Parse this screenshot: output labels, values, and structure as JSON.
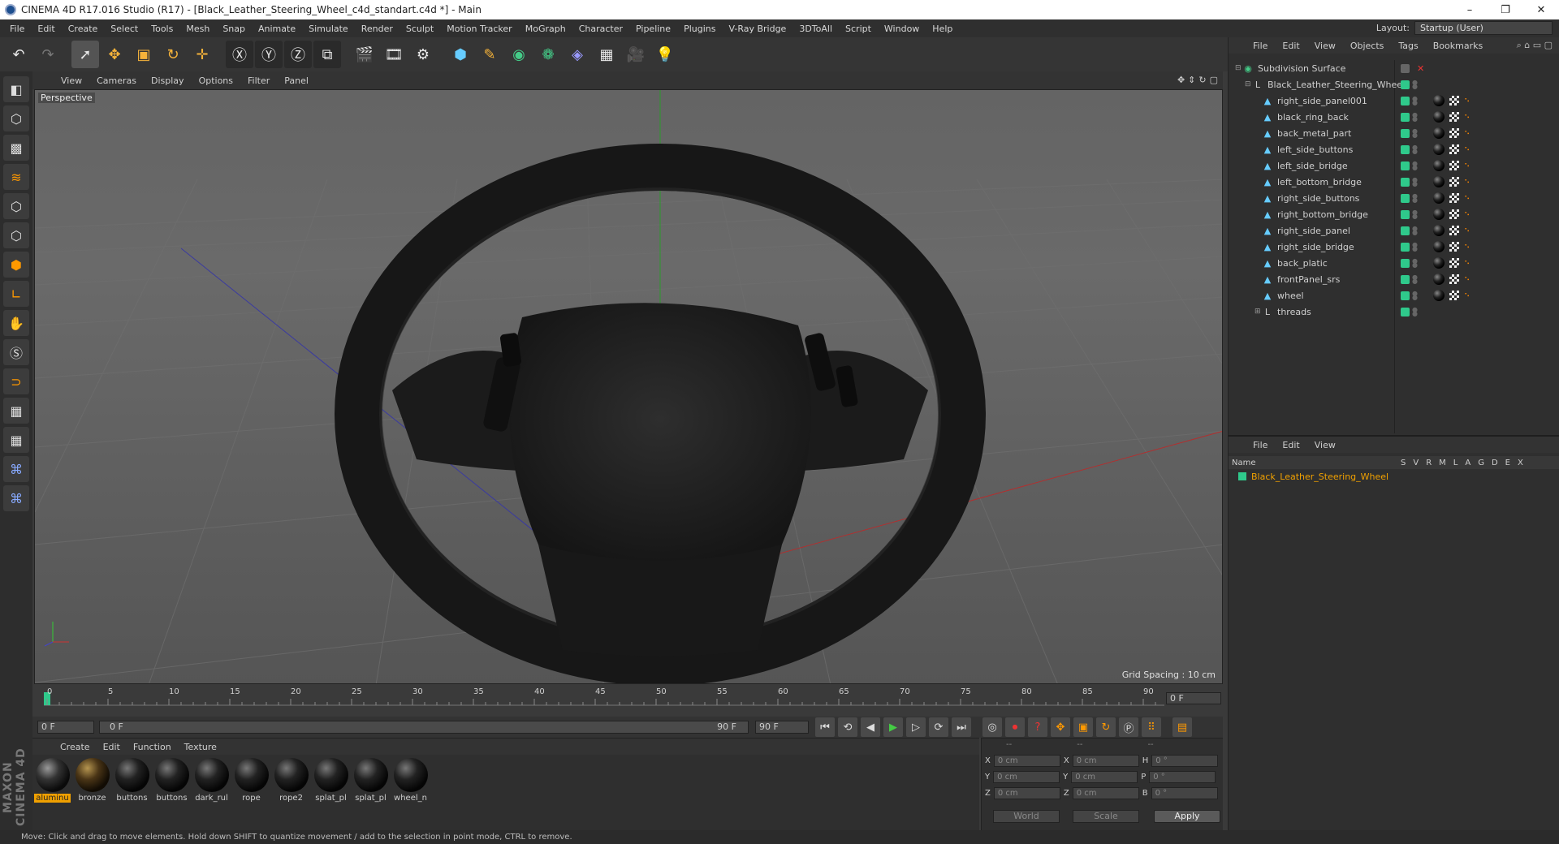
{
  "window": {
    "title": "CINEMA 4D R17.016 Studio (R17) - [Black_Leather_Steering_Wheel_c4d_standart.c4d *] - Main",
    "min": "–",
    "max": "❐",
    "close": "✕"
  },
  "menu": [
    "File",
    "Edit",
    "Create",
    "Select",
    "Tools",
    "Mesh",
    "Snap",
    "Animate",
    "Simulate",
    "Render",
    "Sculpt",
    "Motion Tracker",
    "MoGraph",
    "Character",
    "Pipeline",
    "Plugins",
    "V-Ray Bridge",
    "3DToAll",
    "Script",
    "Window",
    "Help"
  ],
  "layout": {
    "label": "Layout:",
    "value": "Startup (User)"
  },
  "viewport": {
    "menu": [
      "View",
      "Cameras",
      "Display",
      "Options",
      "Filter",
      "Panel"
    ],
    "label": "Perspective",
    "grid_spacing": "Grid Spacing : 10 cm"
  },
  "timeline": {
    "ticks": [
      "0",
      "5",
      "10",
      "15",
      "20",
      "25",
      "30",
      "35",
      "40",
      "45",
      "50",
      "55",
      "60",
      "65",
      "70",
      "75",
      "80",
      "85",
      "90"
    ],
    "current_frame": "0 F",
    "start": "0 F",
    "slider_start": "0 F",
    "slider_end": "90 F",
    "end": "90 F"
  },
  "materials": {
    "menu": [
      "Create",
      "Edit",
      "Function",
      "Texture"
    ],
    "items": [
      {
        "name": "aluminu",
        "kind": "alum",
        "selected": true
      },
      {
        "name": "bronze",
        "kind": "bronze"
      },
      {
        "name": "buttons",
        "kind": "dark"
      },
      {
        "name": "buttons",
        "kind": "dark"
      },
      {
        "name": "dark_rul",
        "kind": "dark"
      },
      {
        "name": "rope",
        "kind": "dark"
      },
      {
        "name": "rope2",
        "kind": "dark"
      },
      {
        "name": "splat_pl",
        "kind": "dark"
      },
      {
        "name": "splat_pl",
        "kind": "dark"
      },
      {
        "name": "wheel_n",
        "kind": "dark"
      }
    ]
  },
  "coords": {
    "headers": [
      "--",
      "--",
      "--"
    ],
    "rows": [
      {
        "a": "X",
        "av": "0 cm",
        "b": "X",
        "bv": "0 cm",
        "c": "H",
        "cv": "0 °"
      },
      {
        "a": "Y",
        "av": "0 cm",
        "b": "Y",
        "bv": "0 cm",
        "c": "P",
        "cv": "0 °"
      },
      {
        "a": "Z",
        "av": "0 cm",
        "b": "Z",
        "bv": "0 cm",
        "c": "B",
        "cv": "0 °"
      }
    ],
    "world": "World",
    "scale": "Scale",
    "apply": "Apply"
  },
  "objects": {
    "menu": [
      "File",
      "Edit",
      "View",
      "Objects",
      "Tags",
      "Bookmarks"
    ],
    "rows": [
      {
        "name": "Subdivision Surface",
        "indent": 0,
        "icon": "subdivision-icon",
        "tags": false
      },
      {
        "name": "Black_Leather_Steering_Wheel",
        "indent": 1,
        "icon": "null-icon",
        "tags": false
      },
      {
        "name": "right_side_panel001",
        "indent": 2,
        "icon": "polygon-icon",
        "tags": true
      },
      {
        "name": "black_ring_back",
        "indent": 2,
        "icon": "polygon-icon",
        "tags": true
      },
      {
        "name": "back_metal_part",
        "indent": 2,
        "icon": "polygon-icon",
        "tags": true
      },
      {
        "name": "left_side_buttons",
        "indent": 2,
        "icon": "polygon-icon",
        "tags": true
      },
      {
        "name": "left_side_bridge",
        "indent": 2,
        "icon": "polygon-icon",
        "tags": true
      },
      {
        "name": "left_bottom_bridge",
        "indent": 2,
        "icon": "polygon-icon",
        "tags": true
      },
      {
        "name": "right_side_buttons",
        "indent": 2,
        "icon": "polygon-icon",
        "tags": true
      },
      {
        "name": "right_bottom_bridge",
        "indent": 2,
        "icon": "polygon-icon",
        "tags": true
      },
      {
        "name": "right_side_panel",
        "indent": 2,
        "icon": "polygon-icon",
        "tags": true
      },
      {
        "name": "right_side_bridge",
        "indent": 2,
        "icon": "polygon-icon",
        "tags": true
      },
      {
        "name": "back_platic",
        "indent": 2,
        "icon": "polygon-icon",
        "tags": true
      },
      {
        "name": "frontPanel_srs",
        "indent": 2,
        "icon": "polygon-icon",
        "tags": true
      },
      {
        "name": "wheel",
        "indent": 2,
        "icon": "polygon-icon",
        "tags": true
      },
      {
        "name": "threads",
        "indent": 2,
        "icon": "null-icon",
        "tags": false
      }
    ]
  },
  "layers": {
    "menu": [
      "File",
      "Edit",
      "View"
    ],
    "name_header": "Name",
    "cols": [
      "S",
      "V",
      "R",
      "M",
      "L",
      "A",
      "G",
      "D",
      "E",
      "X"
    ],
    "row": "Black_Leather_Steering_Wheel"
  },
  "status": "Move: Click and drag to move elements. Hold down SHIFT to quantize movement / add to the selection in point mode, CTRL to remove.",
  "maxon": "MAXON CINEMA 4D"
}
